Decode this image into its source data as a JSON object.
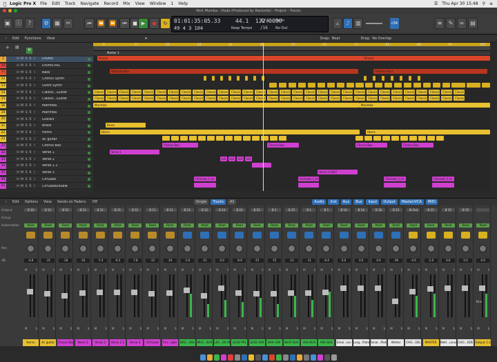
{
  "menubar": {
    "apple": "",
    "app": "Logic Pro X",
    "items": [
      "File",
      "Edit",
      "Track",
      "Navigate",
      "Record",
      "Mix",
      "View",
      "Window",
      "1",
      "Help"
    ],
    "clock": "Thu Apr 30  15:48"
  },
  "window_title": "Nick Mumba - Dada (Produced by Raisizzle) - Project - Tracks",
  "lcd": {
    "position_smpte": "01:01:35:05.33",
    "position_bars": "49  4  3  104",
    "tempo_value": "44.1",
    "tempo_bpm": "122.0000",
    "tempo_label": "Keep Tempo",
    "signature": "4/4",
    "division": "/16",
    "input": "No In",
    "output": "No Out"
  },
  "controlbar": {
    "badge": "c34"
  },
  "arrange_toolbar": {
    "edit": "Edit",
    "functions": "Functions",
    "view": "View",
    "snap_label": "Snap:",
    "snap_value": "Beat",
    "drag_label": "Drag:",
    "drag_value": "No Overlap"
  },
  "ruler": {
    "ticks": [
      "9",
      "17",
      "25",
      "33",
      "41",
      "49",
      "57",
      "65",
      "73",
      "81",
      "89",
      "97",
      "105"
    ],
    "marker": "Marker 1"
  },
  "tracks": [
    {
      "num": "1",
      "name": "Drums",
      "color": "#e8a83a"
    },
    {
      "num": "10",
      "name": "Drums.PRL",
      "color": "#e04040"
    },
    {
      "num": "11",
      "name": "Bass",
      "color": "#e85030"
    },
    {
      "num": "12",
      "name": "Chorus Synth",
      "color": "#e8c030"
    },
    {
      "num": "13",
      "name": "Outro Synth",
      "color": "#e8c030"
    },
    {
      "num": "14",
      "name": "Classic...Guitar",
      "color": "#e8c030"
    },
    {
      "num": "15",
      "name": "Classic...Guitar",
      "color": "#e8c030"
    },
    {
      "num": "16",
      "name": "Marimba",
      "color": "#e8c030"
    },
    {
      "num": "19",
      "name": "Marimba",
      "color": "#e8c030"
    },
    {
      "num": "20",
      "name": "Guitars",
      "color": "#e8c030"
    },
    {
      "num": "21",
      "name": "Brass",
      "color": "#e8c030"
    },
    {
      "num": "22",
      "name": "Horns",
      "color": "#e8c030"
    },
    {
      "num": "23",
      "name": "Ac guitar",
      "color": "#e8c030"
    },
    {
      "num": "24",
      "name": "Chorus Bax",
      "color": "#d040d0"
    },
    {
      "num": "32",
      "name": "Verse 1",
      "color": "#d040d0"
    },
    {
      "num": "33",
      "name": "Verse 2",
      "color": "#d040d0"
    },
    {
      "num": "34",
      "name": "Verse 2 2",
      "color": "#d040d0"
    },
    {
      "num": "35",
      "name": "Verse 3",
      "color": "#d040d0"
    },
    {
      "num": "40",
      "name": "ChrLead",
      "color": "#d040d0"
    },
    {
      "num": "41",
      "name": "ChrLeadDouble",
      "color": "#d040d0"
    }
  ],
  "regions": {
    "drums1": "Drums",
    "drums2": "Drums",
    "bass1": "Attitude Bass",
    "bass2": "Attitude Bass",
    "gtr": "Classical",
    "marimba1": "Marimba",
    "marimba2": "Marimba",
    "brass": "Brass",
    "horns": "Horns",
    "chorusbax": "Chorus Bax",
    "verse1": "Verse 1",
    "verse2": "vid",
    "verse3": "Verse 2 2907",
    "chrlead": "ChrLead_1_bl"
  },
  "mixer_toolbar": {
    "edit": "Edit",
    "options": "Options",
    "view": "View",
    "sends": "Sends on Faders:",
    "sends_value": "Off",
    "tabs": [
      "Single",
      "Tracks",
      "All"
    ],
    "filters": [
      "Audio",
      "Inst",
      "Aux",
      "Bus",
      "Input",
      "Output",
      "Master/VCA",
      "MIDI"
    ]
  },
  "mixer_rows": [
    "Output",
    "Group",
    "Automation",
    "Pan",
    "dB"
  ],
  "strips": [
    {
      "io": "B 10",
      "auto": "Read",
      "db": "-4.6",
      "name": "Horns",
      "color": "#e8c030",
      "fader": 0.62,
      "meter": 0.0
    },
    {
      "io": "B 11",
      "auto": "Read",
      "db": "-15",
      "name": "Ac guitar",
      "color": "#e8c030",
      "fader": 0.55,
      "meter": 0.0
    },
    {
      "io": "B 12",
      "auto": "Read",
      "db": "-18",
      "name": "Chorus Bax",
      "color": "#d040d0",
      "fader": 0.5,
      "meter": 0.0
    },
    {
      "io": "B 11",
      "auto": "Read",
      "db": "-10",
      "name": "Verse 1",
      "color": "#d040d0",
      "fader": 0.58,
      "meter": 0.0
    },
    {
      "io": "B 11",
      "auto": "Read",
      "db": "-7.4",
      "name": "Verse 2",
      "color": "#d040d0",
      "fader": 0.6,
      "meter": 0.0
    },
    {
      "io": "B 11",
      "auto": "Read",
      "db": "-6.5",
      "name": "Verse 2 2",
      "color": "#d040d0",
      "fader": 0.6,
      "meter": 0.0
    },
    {
      "io": "B 11",
      "auto": "Read",
      "db": "-7.8",
      "name": "Verse 3",
      "color": "#d040d0",
      "fader": 0.6,
      "meter": 0.0
    },
    {
      "io": "B 11",
      "auto": "Read",
      "db": "-15",
      "name": "ChrLead",
      "color": "#d040d0",
      "fader": 0.55,
      "meter": 0.0
    },
    {
      "io": "B 11",
      "auto": "Read",
      "db": "-10",
      "name": "Chr...uble",
      "color": "#d040d0",
      "fader": 0.58,
      "meter": 0.0
    },
    {
      "io": "B 11",
      "auto": "Read",
      "db": "-3.0",
      "name": "DRU...ASS",
      "color": "#3bb54a",
      "fader": 0.65,
      "meter": 0.55
    },
    {
      "io": "B 12",
      "auto": "Read",
      "db": "-21",
      "name": "MUS...BUS",
      "color": "#3bb54a",
      "fader": 0.5,
      "meter": 0.3
    },
    {
      "io": "B 14",
      "auto": "Read",
      "db": "0.0",
      "name": "LEA...OX IN",
      "color": "#3bb54a",
      "fader": 0.7,
      "meter": 0.4
    },
    {
      "io": "B 23",
      "auto": "Read",
      "db": "-9.9",
      "name": "LEAD PRL",
      "color": "#3bb54a",
      "fader": 0.58,
      "meter": 0.35
    },
    {
      "io": "B 23",
      "auto": "Read",
      "db": "-15",
      "name": "LEAD VOX",
      "color": "#3bb54a",
      "fader": 0.55,
      "meter": 0.45
    },
    {
      "io": "B 1",
      "auto": "Read",
      "db": "-15",
      "name": "BAK VOX",
      "color": "#3bb54a",
      "fader": 0.55,
      "meter": 0.3
    },
    {
      "io": "B 15",
      "auto": "Read",
      "db": "-11",
      "name": "BEAT BUS",
      "color": "#3bb54a",
      "fader": 0.57,
      "meter": 0.5
    },
    {
      "io": "B 1",
      "auto": "Read",
      "db": "-11",
      "name": "VOX BUS",
      "color": "#3bb54a",
      "fader": 0.57,
      "meter": 0.4
    },
    {
      "io": "B 1",
      "auto": "Read",
      "db": "-6.4",
      "name": "MIX BUS",
      "color": "#3bb54a",
      "fader": 0.6,
      "meter": 0.6
    },
    {
      "io": "B 14",
      "auto": "Read",
      "db": "0.0",
      "name": "Smal...ion",
      "color": "#e8e8e8",
      "fader": 0.7,
      "meter": 0.0
    },
    {
      "io": "B 14",
      "auto": "Read",
      "db": "0.0",
      "name": "Larg...Plate",
      "color": "#e8e8e8",
      "fader": 0.7,
      "meter": 0.0
    },
    {
      "io": "B 16",
      "auto": "Read",
      "db": "0.0",
      "name": "Smal...Plate",
      "color": "#e8e8e8",
      "fader": 0.7,
      "meter": 0.0
    },
    {
      "io": "B 15",
      "auto": "Read",
      "db": "-39",
      "name": "Wetter",
      "color": "#e8e8e8",
      "fader": 0.35,
      "meter": 0.0
    },
    {
      "io": "St Out",
      "auto": "Read",
      "db": "-4.6",
      "name": "CHO...DEL",
      "color": "#e8e8e8",
      "fader": 0.62,
      "meter": 0.5
    },
    {
      "io": "B 15",
      "auto": "Read",
      "db": "-1.0",
      "name": "MASTER",
      "color": "#e8c030",
      "fader": 0.68,
      "meter": 0.55
    },
    {
      "io": "B 15",
      "auto": "Read",
      "db": "0.0",
      "name": "Wetl...unus",
      "color": "#e8e8e8",
      "fader": 0.7,
      "meter": 0.0
    },
    {
      "io": "B 15",
      "auto": "Read",
      "db": "0.0",
      "name": "CHO...DDE",
      "color": "#e8e8e8",
      "fader": 0.7,
      "meter": 0.0
    },
    {
      "io": "",
      "auto": "Read",
      "db": "0.0",
      "name": "Output 1-2",
      "color": "#e8c030",
      "fader": 0.7,
      "meter": 0.55
    }
  ],
  "output_bnc": "Bnc"
}
